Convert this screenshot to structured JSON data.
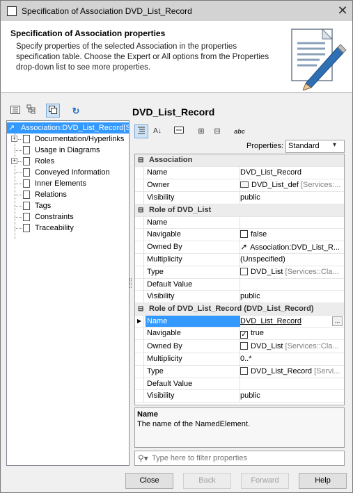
{
  "window": {
    "title": "Specification of Association DVD_List_Record",
    "close_glyph": "✕"
  },
  "header": {
    "title": "Specification of Association properties",
    "description": "Specify properties of the selected Association in the properties specification table. Choose the Expert or All options from the Properties drop-down list to see more properties."
  },
  "left_toolbar": {
    "icons": [
      "tree-view-icon",
      "hierarchy-icon",
      "copy-icon",
      "refresh-icon"
    ]
  },
  "tree": {
    "root_label": "Association:DVD_List_Record[Se",
    "items": [
      {
        "label": "Documentation/Hyperlinks",
        "expandable": true
      },
      {
        "label": "Usage in Diagrams",
        "expandable": false
      },
      {
        "label": "Roles",
        "expandable": true
      },
      {
        "label": "Conveyed Information",
        "expandable": false
      },
      {
        "label": "Inner Elements",
        "expandable": false
      },
      {
        "label": "Relations",
        "expandable": false
      },
      {
        "label": "Tags",
        "expandable": false
      },
      {
        "label": "Constraints",
        "expandable": false
      },
      {
        "label": "Traceability",
        "expandable": false
      }
    ]
  },
  "right": {
    "element_title": "DVD_List_Record",
    "properties_label": "Properties:",
    "properties_value": "Standard"
  },
  "grid": {
    "groups": [
      {
        "title": "Association",
        "rows": [
          {
            "name": "Name",
            "value": "DVD_List_Record",
            "extra": ""
          },
          {
            "name": "Owner",
            "value": "DVD_List_def",
            "extra": "[Services:...",
            "icon": "package"
          },
          {
            "name": "Visibility",
            "value": "public",
            "extra": ""
          }
        ]
      },
      {
        "title": "Role of DVD_List",
        "rows": [
          {
            "name": "Name",
            "value": "",
            "extra": ""
          },
          {
            "name": "Navigable",
            "value": "false",
            "extra": "",
            "icon": "checkbox"
          },
          {
            "name": "Owned By",
            "value": "Association:DVD_List_R...",
            "extra": "",
            "icon": "association"
          },
          {
            "name": "Multiplicity",
            "value": "(Unspecified)",
            "extra": ""
          },
          {
            "name": "Type",
            "value": "DVD_List",
            "extra": "[Services::Cla...",
            "icon": "class"
          },
          {
            "name": "Default Value",
            "value": "",
            "extra": ""
          },
          {
            "name": "Visibility",
            "value": "public",
            "extra": ""
          }
        ]
      },
      {
        "title": "Role of DVD_List_Record (DVD_List_Record)",
        "rows": [
          {
            "name": "Name",
            "value": "DVD_List_Record",
            "extra": "",
            "selected": true,
            "ellipsis": "..."
          },
          {
            "name": "Navigable",
            "value": "true",
            "extra": "",
            "icon": "checkbox-checked"
          },
          {
            "name": "Owned By",
            "value": "DVD_List",
            "extra": "[Services::Cla...",
            "icon": "class"
          },
          {
            "name": "Multiplicity",
            "value": "0..*",
            "extra": ""
          },
          {
            "name": "Type",
            "value": "DVD_List_Record",
            "extra": "[Servi...",
            "icon": "class"
          },
          {
            "name": "Default Value",
            "value": "",
            "extra": ""
          },
          {
            "name": "Visibility",
            "value": "public",
            "extra": ""
          }
        ]
      }
    ]
  },
  "description": {
    "title": "Name",
    "text": "The name of the NamedElement."
  },
  "filter": {
    "placeholder": "Type here to filter properties"
  },
  "buttons": {
    "close": "Close",
    "back": "Back",
    "forward": "Forward",
    "help": "Help"
  }
}
